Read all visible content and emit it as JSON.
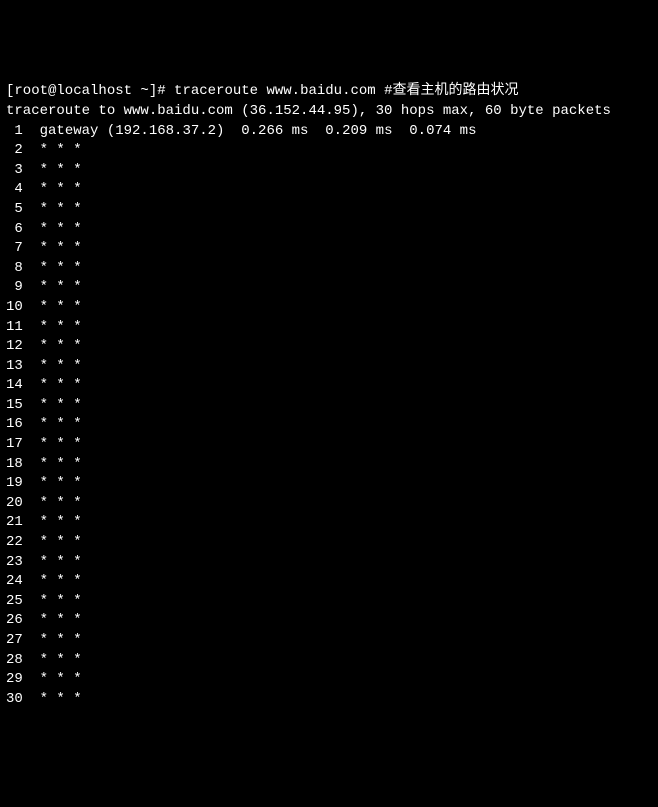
{
  "prompt": {
    "user_host": "[root@localhost ~]#",
    "command": "traceroute www.baidu.com",
    "comment": "#查看主机的路由状况"
  },
  "header": "traceroute to www.baidu.com (36.152.44.95), 30 hops max, 60 byte packets",
  "hops": [
    {
      "num": " 1",
      "text": "  gateway (192.168.37.2)  0.266 ms  0.209 ms  0.074 ms"
    },
    {
      "num": " 2",
      "text": "  * * *"
    },
    {
      "num": " 3",
      "text": "  * * *"
    },
    {
      "num": " 4",
      "text": "  * * *"
    },
    {
      "num": " 5",
      "text": "  * * *"
    },
    {
      "num": " 6",
      "text": "  * * *"
    },
    {
      "num": " 7",
      "text": "  * * *"
    },
    {
      "num": " 8",
      "text": "  * * *"
    },
    {
      "num": " 9",
      "text": "  * * *"
    },
    {
      "num": "10",
      "text": "  * * *"
    },
    {
      "num": "11",
      "text": "  * * *"
    },
    {
      "num": "12",
      "text": "  * * *"
    },
    {
      "num": "13",
      "text": "  * * *"
    },
    {
      "num": "14",
      "text": "  * * *"
    },
    {
      "num": "15",
      "text": "  * * *"
    },
    {
      "num": "16",
      "text": "  * * *"
    },
    {
      "num": "17",
      "text": "  * * *"
    },
    {
      "num": "18",
      "text": "  * * *"
    },
    {
      "num": "19",
      "text": "  * * *"
    },
    {
      "num": "20",
      "text": "  * * *"
    },
    {
      "num": "21",
      "text": "  * * *"
    },
    {
      "num": "22",
      "text": "  * * *"
    },
    {
      "num": "23",
      "text": "  * * *"
    },
    {
      "num": "24",
      "text": "  * * *"
    },
    {
      "num": "25",
      "text": "  * * *"
    },
    {
      "num": "26",
      "text": "  * * *"
    },
    {
      "num": "27",
      "text": "  * * *"
    },
    {
      "num": "28",
      "text": "  * * *"
    },
    {
      "num": "29",
      "text": "  * * *"
    },
    {
      "num": "30",
      "text": "  * * *"
    }
  ]
}
